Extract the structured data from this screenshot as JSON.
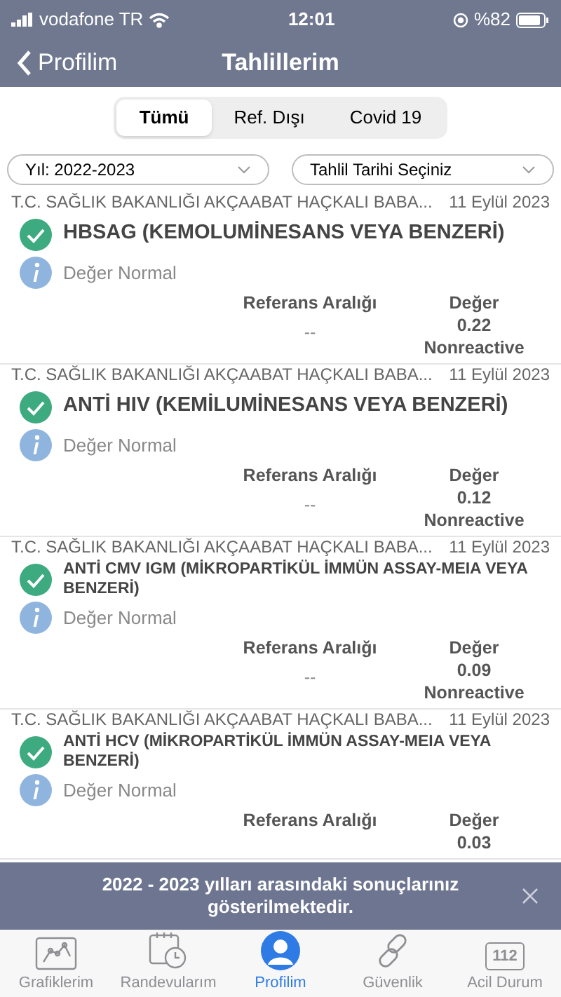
{
  "status_bar": {
    "carrier": "vodafone TR",
    "time": "12:01",
    "battery": "%82"
  },
  "nav": {
    "back": "Profilim",
    "title": "Tahlillerim"
  },
  "segments": [
    {
      "label": "Tümü",
      "selected": true
    },
    {
      "label": "Ref. Dışı",
      "selected": false
    },
    {
      "label": "Covid 19",
      "selected": false
    }
  ],
  "filters": [
    {
      "value": "Yıl: 2022-2023"
    },
    {
      "value": "Tahlil Tarihi Seçiniz"
    }
  ],
  "results": [
    {
      "source": "T.C. SAĞLIK BAKANLIĞI AKÇAABAT HAÇKALI BABA...",
      "date": "11 Eylül 2023",
      "title": "HBSAG (KEMOLUMİNESANS VEYA BENZERİ)",
      "status": "Değer Normal",
      "ref_header": "Referans Aralığı",
      "value_header": "Değer",
      "ref": "--",
      "value": "0.22",
      "note": "Nonreactive"
    },
    {
      "source": "T.C. SAĞLIK BAKANLIĞI AKÇAABAT HAÇKALI BABA...",
      "date": "11 Eylül 2023",
      "title": "ANTİ HIV (KEMİLUMİNESANS VEYA BENZERİ)",
      "status": "Değer Normal",
      "ref_header": "Referans Aralığı",
      "value_header": "Değer",
      "ref": "--",
      "value": "0.12",
      "note": "Nonreactive"
    },
    {
      "source": "T.C. SAĞLIK BAKANLIĞI AKÇAABAT HAÇKALI BABA...",
      "date": "11 Eylül 2023",
      "title": "ANTİ CMV IGM (MİKROPARTİKÜL İMMÜN ASSAY-MEIA VEYA BENZERİ)",
      "status": "Değer Normal",
      "ref_header": "Referans Aralığı",
      "value_header": "Değer",
      "ref": "--",
      "value": "0.09",
      "note": "Nonreactive"
    },
    {
      "source": "T.C. SAĞLIK BAKANLIĞI AKÇAABAT HAÇKALI BABA...",
      "date": "11 Eylül 2023",
      "title": "ANTİ HCV (MİKROPARTİKÜL İMMÜN ASSAY-MEIA VEYA BENZERİ)",
      "status": "Değer Normal",
      "ref_header": "Referans Aralığı",
      "value_header": "Değer",
      "value": "0.03"
    }
  ],
  "toast": {
    "message": "2022 - 2023 yılları arasındaki sonuçlarınız gösterilmektedir."
  },
  "tab_bar": [
    {
      "kind": "chart",
      "label": "Grafiklerim",
      "selected": false
    },
    {
      "kind": "calendar",
      "label": "Randevularım",
      "selected": false
    },
    {
      "kind": "profile",
      "label": "Profilim",
      "selected": true
    },
    {
      "kind": "link",
      "label": "Güvenlik",
      "selected": false
    },
    {
      "kind": "emergency",
      "label": "Acil Durum",
      "icon_text": "112",
      "selected": false
    }
  ]
}
